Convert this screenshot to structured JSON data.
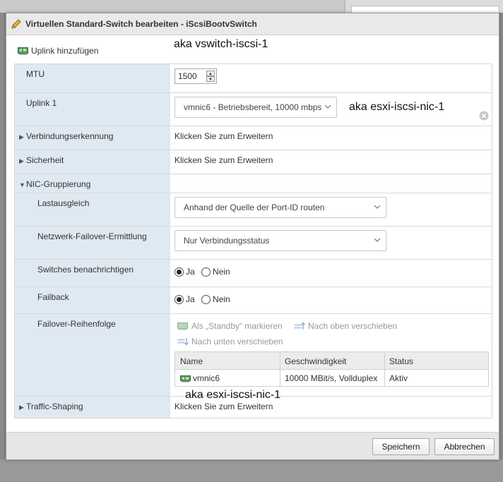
{
  "dialog": {
    "title": "Virtuellen Standard-Switch bearbeiten - iScsiBootvSwitch",
    "add_uplink_label": "Uplink hinzufügen",
    "annotation_top": "aka vswitch-iscsi-1"
  },
  "form": {
    "mtu": {
      "label": "MTU",
      "value": "1500"
    },
    "uplink1": {
      "label": "Uplink 1",
      "selected": "vmnic6 - Betriebsbereit, 10000 mbps",
      "annotation": "aka esxi-iscsi-nic-1"
    },
    "link_discovery": {
      "label": "Verbindungserkennung",
      "value": "Klicken Sie zum Erweitern"
    },
    "security": {
      "label": "Sicherheit",
      "value": "Klicken Sie zum Erweitern"
    },
    "nic_teaming": {
      "label": "NIC-Gruppierung",
      "load_balancing": {
        "label": "Lastausgleich",
        "selected": "Anhand der Quelle der Port-ID routen"
      },
      "failover_detection": {
        "label": "Netzwerk-Failover-Ermittlung",
        "selected": "Nur Verbindungsstatus"
      },
      "notify_switches": {
        "label": "Switches benachrichtigen",
        "yes": "Ja",
        "no": "Nein",
        "selected": "yes"
      },
      "failback": {
        "label": "Failback",
        "yes": "Ja",
        "no": "Nein",
        "selected": "yes"
      },
      "failover_order": {
        "label": "Failover-Reihenfolge",
        "mark_standby": "Als „Standby“ markieren",
        "move_up": "Nach oben verschieben",
        "move_down": "Nach unten verschieben",
        "columns": [
          "Name",
          "Geschwindigkeit",
          "Status"
        ],
        "rows": [
          [
            "vmnic6",
            "10000 MBit/s, Vollduplex",
            "Aktiv"
          ]
        ],
        "annotation": "aka esxi-iscsi-nic-1"
      }
    },
    "traffic_shaping": {
      "label": "Traffic-Shaping",
      "value": "Klicken Sie zum Erweitern"
    }
  },
  "footer": {
    "save_label": "Speichern",
    "cancel_label": "Abbrechen"
  },
  "colors": {
    "label_column": "#dfe9f2",
    "title_bar": "#e9e9e9",
    "footer": "#e6e6e6"
  }
}
